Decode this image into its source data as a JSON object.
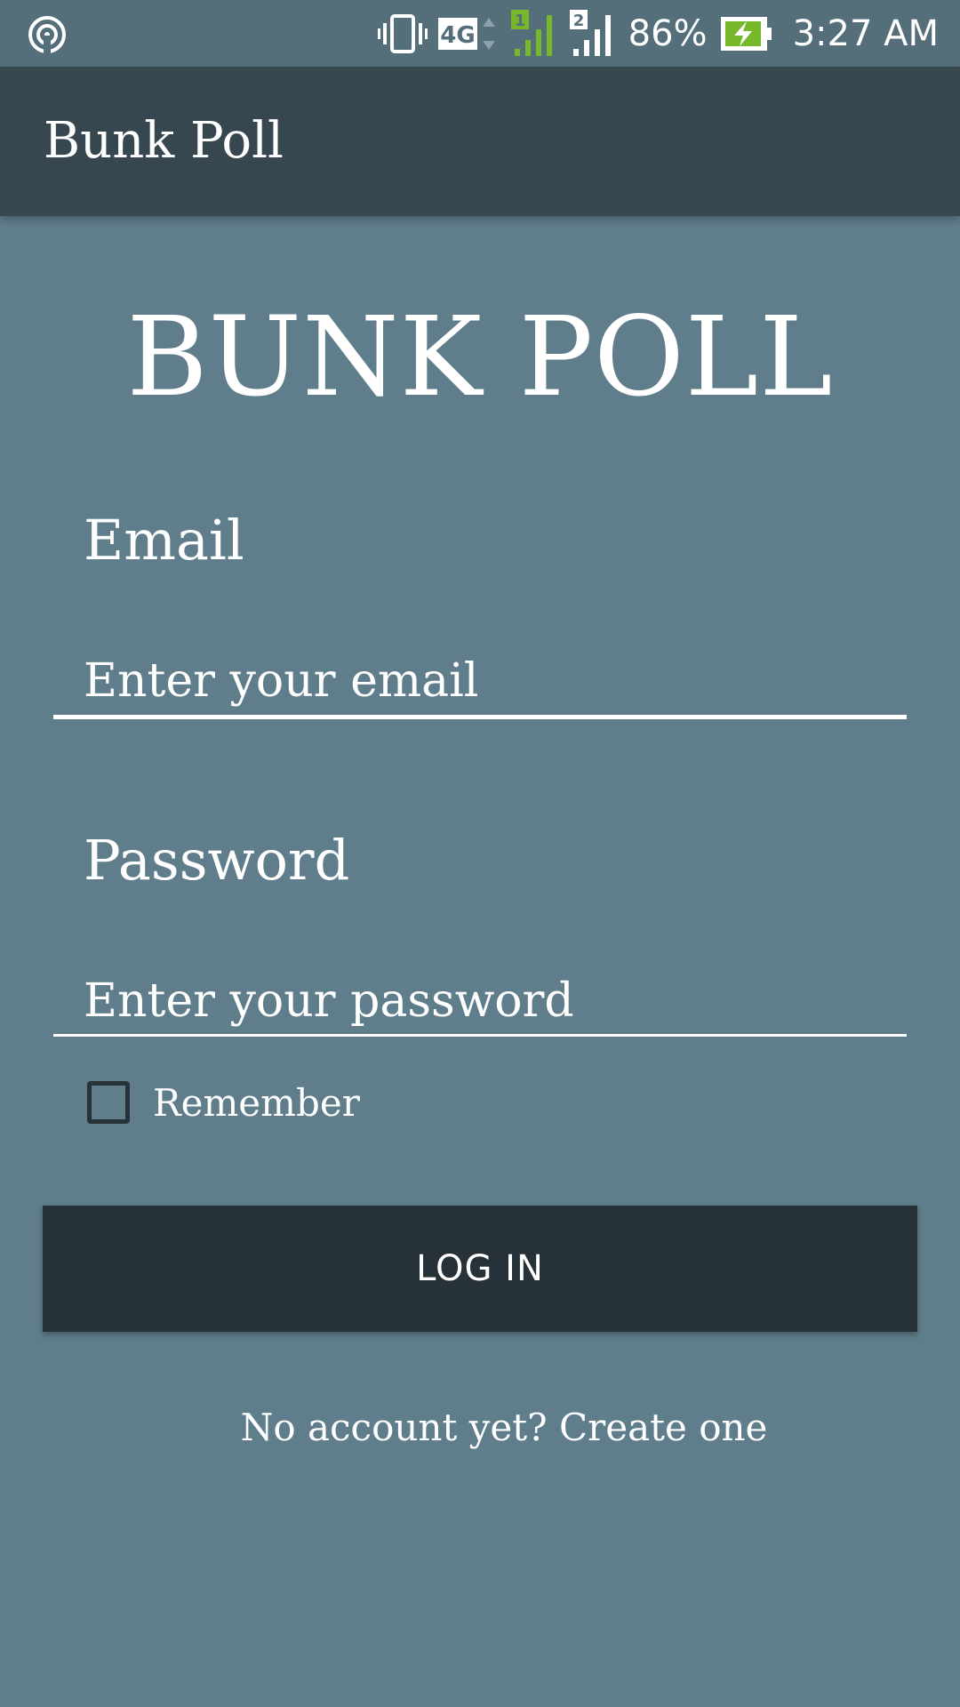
{
  "status_bar": {
    "left_icon": "hotspot-icon",
    "icons": [
      "vibrate-icon",
      "4g-icon",
      "signal-sim1-icon",
      "signal-sim2-icon"
    ],
    "network": "4G",
    "sim1": "1",
    "sim2": "2",
    "battery": "86%",
    "battery_icon": "battery-charging-icon",
    "time": "3:27 AM"
  },
  "app_bar": {
    "title": "Bunk Poll"
  },
  "hero": {
    "title": "BUNK POLL"
  },
  "form": {
    "email_label": "Email",
    "email_placeholder": "Enter your email",
    "email_value": "",
    "password_label": "Password",
    "password_placeholder": "Enter your password",
    "password_value": "",
    "remember_label": "Remember",
    "remember_checked": false,
    "login_label": "LOG IN",
    "signup_text": "No account yet? Create one"
  },
  "colors": {
    "background": "#607D8B",
    "status_bar": "#546E7A",
    "app_bar": "#37474F",
    "button": "#263238",
    "text": "#FFFFFF",
    "signal_green": "#76B82A"
  }
}
